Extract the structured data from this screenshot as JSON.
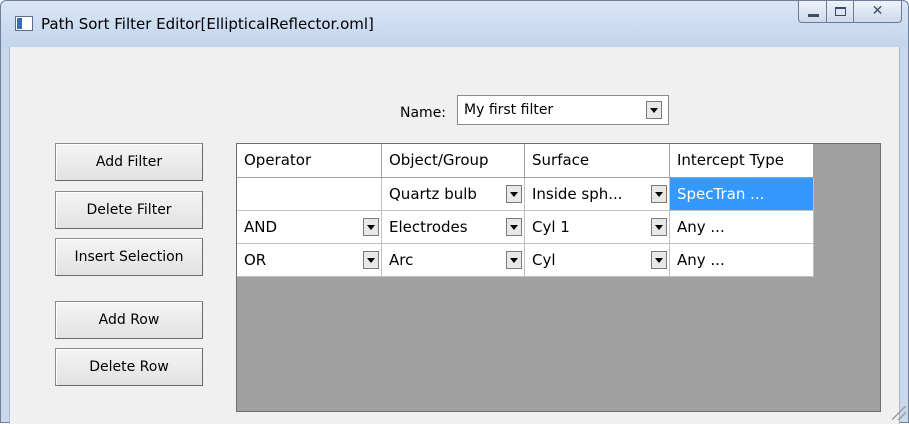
{
  "window": {
    "title": "Path Sort Filter Editor[EllipticalReflector.oml]",
    "close_glyph": "✕"
  },
  "name_field": {
    "label": "Name:",
    "value": "My first filter"
  },
  "buttons": {
    "add_filter": "Add Filter",
    "delete_filter": "Delete Filter",
    "insert_selection": "Insert Selection",
    "add_row": "Add Row",
    "delete_row": "Delete Row"
  },
  "grid": {
    "headers": [
      "Operator",
      "Object/Group",
      "Surface",
      "Intercept Type"
    ],
    "rows": [
      {
        "operator": "",
        "object": "Quartz bulb",
        "surface": "Inside sph...",
        "intercept": "SpecTran ..."
      },
      {
        "operator": "AND",
        "object": "Electrodes",
        "surface": "Cyl 1",
        "intercept": "Any ..."
      },
      {
        "operator": "OR",
        "object": "Arc",
        "surface": "Cyl",
        "intercept": "Any ..."
      }
    ]
  },
  "colors": {
    "selection": "#3399ff",
    "grid_background": "#a0a0a0",
    "title_bar": "#c9d8ec"
  }
}
